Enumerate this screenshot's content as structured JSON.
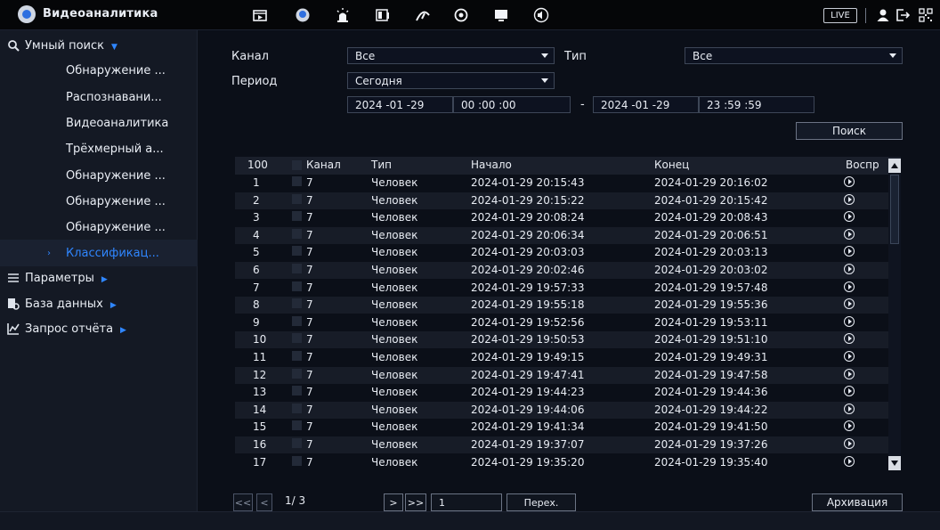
{
  "app": {
    "title": "Видеоаналитика",
    "live_badge": "LIVE"
  },
  "topbar_icons": [
    "playback-icon",
    "face-icon",
    "alarm-icon",
    "display-icon",
    "network-icon",
    "ptz-icon",
    "monitor-icon",
    "audio-icon"
  ],
  "topbar_right_icons": [
    "user-icon",
    "logout-icon",
    "qr-icon"
  ],
  "sidebar": {
    "section_label": "Умный поиск",
    "items": [
      {
        "label": "Обнаружение ..."
      },
      {
        "label": "Распознавани..."
      },
      {
        "label": "Видеоаналитика"
      },
      {
        "label": "Трёхмерный а..."
      },
      {
        "label": "Обнаружение ..."
      },
      {
        "label": "Обнаружение ..."
      },
      {
        "label": "Обнаружение ..."
      },
      {
        "label": "Классификац..."
      }
    ],
    "groups": [
      {
        "label": "Параметры"
      },
      {
        "label": "База данных"
      },
      {
        "label": "Запрос отчёта"
      }
    ]
  },
  "filters": {
    "channel_label": "Канал",
    "channel_value": "Все",
    "type_label": "Тип",
    "type_value": "Все",
    "period_label": "Период",
    "period_value": "Сегодня",
    "start_date": "2024 -01 -29",
    "start_time": "00 :00 :00",
    "range_sep": "-",
    "end_date": "2024 -01 -29",
    "end_time": "23 :59 :59",
    "search_label": "Поиск"
  },
  "table": {
    "count_header": "100",
    "headers": [
      "Канал",
      "Тип",
      "Начало",
      "Конец",
      "Воспр"
    ],
    "rows": [
      {
        "n": "1",
        "ch": "7",
        "type": "Человек",
        "start": "2024-01-29 20:15:43",
        "end": "2024-01-29 20:16:02"
      },
      {
        "n": "2",
        "ch": "7",
        "type": "Человек",
        "start": "2024-01-29 20:15:22",
        "end": "2024-01-29 20:15:42"
      },
      {
        "n": "3",
        "ch": "7",
        "type": "Человек",
        "start": "2024-01-29 20:08:24",
        "end": "2024-01-29 20:08:43"
      },
      {
        "n": "4",
        "ch": "7",
        "type": "Человек",
        "start": "2024-01-29 20:06:34",
        "end": "2024-01-29 20:06:51"
      },
      {
        "n": "5",
        "ch": "7",
        "type": "Человек",
        "start": "2024-01-29 20:03:03",
        "end": "2024-01-29 20:03:13"
      },
      {
        "n": "6",
        "ch": "7",
        "type": "Человек",
        "start": "2024-01-29 20:02:46",
        "end": "2024-01-29 20:03:02"
      },
      {
        "n": "7",
        "ch": "7",
        "type": "Человек",
        "start": "2024-01-29 19:57:33",
        "end": "2024-01-29 19:57:48"
      },
      {
        "n": "8",
        "ch": "7",
        "type": "Человек",
        "start": "2024-01-29 19:55:18",
        "end": "2024-01-29 19:55:36"
      },
      {
        "n": "9",
        "ch": "7",
        "type": "Человек",
        "start": "2024-01-29 19:52:56",
        "end": "2024-01-29 19:53:11"
      },
      {
        "n": "10",
        "ch": "7",
        "type": "Человек",
        "start": "2024-01-29 19:50:53",
        "end": "2024-01-29 19:51:10"
      },
      {
        "n": "11",
        "ch": "7",
        "type": "Человек",
        "start": "2024-01-29 19:49:15",
        "end": "2024-01-29 19:49:31"
      },
      {
        "n": "12",
        "ch": "7",
        "type": "Человек",
        "start": "2024-01-29 19:47:41",
        "end": "2024-01-29 19:47:58"
      },
      {
        "n": "13",
        "ch": "7",
        "type": "Человек",
        "start": "2024-01-29 19:44:23",
        "end": "2024-01-29 19:44:36"
      },
      {
        "n": "14",
        "ch": "7",
        "type": "Человек",
        "start": "2024-01-29 19:44:06",
        "end": "2024-01-29 19:44:22"
      },
      {
        "n": "15",
        "ch": "7",
        "type": "Человек",
        "start": "2024-01-29 19:41:34",
        "end": "2024-01-29 19:41:50"
      },
      {
        "n": "16",
        "ch": "7",
        "type": "Человек",
        "start": "2024-01-29 19:37:07",
        "end": "2024-01-29 19:37:26"
      },
      {
        "n": "17",
        "ch": "7",
        "type": "Человек",
        "start": "2024-01-29 19:35:20",
        "end": "2024-01-29 19:35:40"
      }
    ]
  },
  "pager": {
    "first": "<<",
    "prev": "<",
    "page_info": "1/ 3",
    "next": ">",
    "last": ">>",
    "goto_value": "1",
    "goto_label": "Перех.",
    "archive_label": "Архивация"
  },
  "colors": {
    "accent": "#2f86ff",
    "background": "#0b0f18",
    "sidebar": "#141924"
  }
}
